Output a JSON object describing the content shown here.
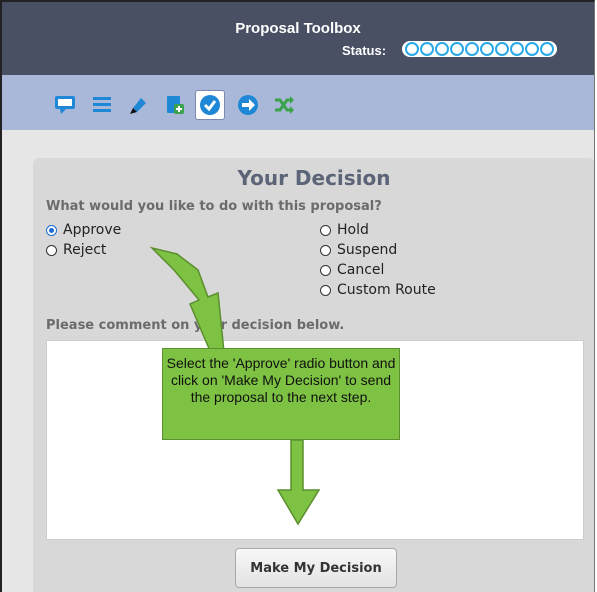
{
  "header": {
    "title": "Proposal Toolbox",
    "status_label": "Status:",
    "status_steps": 10
  },
  "toolbar": {
    "icons": [
      "comment-icon",
      "list-icon",
      "pen-icon",
      "add-page-icon",
      "checkmark-icon",
      "next-arrow-icon",
      "shuffle-icon"
    ],
    "active_icon": "checkmark-icon"
  },
  "decision": {
    "title": "Your Decision",
    "question": "What would you like to do with this proposal?",
    "options_left": [
      "Approve",
      "Reject"
    ],
    "options_right": [
      "Hold",
      "Suspend",
      "Cancel",
      "Custom Route"
    ],
    "selected": "Approve",
    "comment_label": "Please comment on your decision below.",
    "comment_value": "",
    "submit_label": "Make My Decision"
  },
  "callout": {
    "text": "Select the 'Approve' radio button and click on 'Make My Decision' to send the proposal to the next step."
  },
  "colors": {
    "header_bg": "#4a5063",
    "toolbar_bg": "#a9b8d9",
    "icon_blue": "#1e88d6",
    "icon_green": "#3aa34a",
    "callout_green": "#7dc242",
    "status_ring": "#2aa8e6"
  }
}
